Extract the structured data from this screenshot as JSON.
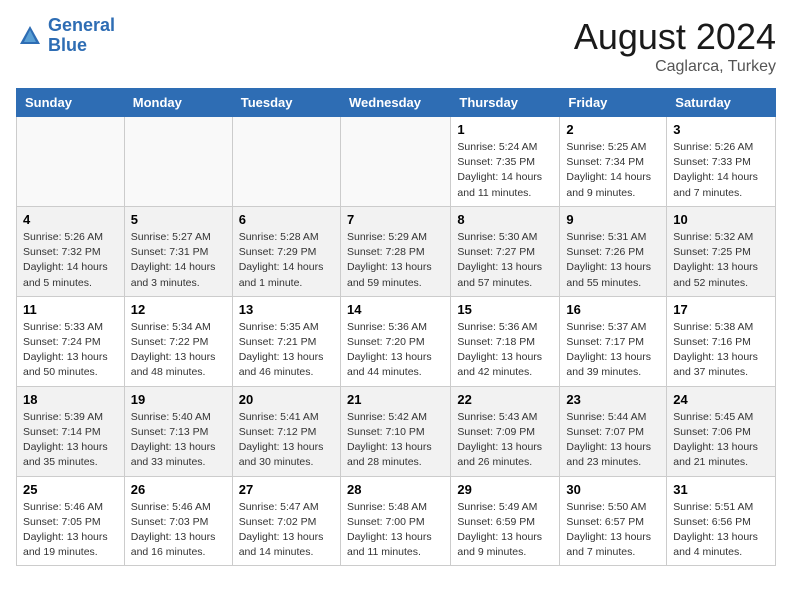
{
  "header": {
    "logo_line1": "General",
    "logo_line2": "Blue",
    "month": "August 2024",
    "location": "Caglarca, Turkey"
  },
  "weekdays": [
    "Sunday",
    "Monday",
    "Tuesday",
    "Wednesday",
    "Thursday",
    "Friday",
    "Saturday"
  ],
  "weeks": [
    [
      {
        "day": "",
        "info": ""
      },
      {
        "day": "",
        "info": ""
      },
      {
        "day": "",
        "info": ""
      },
      {
        "day": "",
        "info": ""
      },
      {
        "day": "1",
        "info": "Sunrise: 5:24 AM\nSunset: 7:35 PM\nDaylight: 14 hours\nand 11 minutes."
      },
      {
        "day": "2",
        "info": "Sunrise: 5:25 AM\nSunset: 7:34 PM\nDaylight: 14 hours\nand 9 minutes."
      },
      {
        "day": "3",
        "info": "Sunrise: 5:26 AM\nSunset: 7:33 PM\nDaylight: 14 hours\nand 7 minutes."
      }
    ],
    [
      {
        "day": "4",
        "info": "Sunrise: 5:26 AM\nSunset: 7:32 PM\nDaylight: 14 hours\nand 5 minutes."
      },
      {
        "day": "5",
        "info": "Sunrise: 5:27 AM\nSunset: 7:31 PM\nDaylight: 14 hours\nand 3 minutes."
      },
      {
        "day": "6",
        "info": "Sunrise: 5:28 AM\nSunset: 7:29 PM\nDaylight: 14 hours\nand 1 minute."
      },
      {
        "day": "7",
        "info": "Sunrise: 5:29 AM\nSunset: 7:28 PM\nDaylight: 13 hours\nand 59 minutes."
      },
      {
        "day": "8",
        "info": "Sunrise: 5:30 AM\nSunset: 7:27 PM\nDaylight: 13 hours\nand 57 minutes."
      },
      {
        "day": "9",
        "info": "Sunrise: 5:31 AM\nSunset: 7:26 PM\nDaylight: 13 hours\nand 55 minutes."
      },
      {
        "day": "10",
        "info": "Sunrise: 5:32 AM\nSunset: 7:25 PM\nDaylight: 13 hours\nand 52 minutes."
      }
    ],
    [
      {
        "day": "11",
        "info": "Sunrise: 5:33 AM\nSunset: 7:24 PM\nDaylight: 13 hours\nand 50 minutes."
      },
      {
        "day": "12",
        "info": "Sunrise: 5:34 AM\nSunset: 7:22 PM\nDaylight: 13 hours\nand 48 minutes."
      },
      {
        "day": "13",
        "info": "Sunrise: 5:35 AM\nSunset: 7:21 PM\nDaylight: 13 hours\nand 46 minutes."
      },
      {
        "day": "14",
        "info": "Sunrise: 5:36 AM\nSunset: 7:20 PM\nDaylight: 13 hours\nand 44 minutes."
      },
      {
        "day": "15",
        "info": "Sunrise: 5:36 AM\nSunset: 7:18 PM\nDaylight: 13 hours\nand 42 minutes."
      },
      {
        "day": "16",
        "info": "Sunrise: 5:37 AM\nSunset: 7:17 PM\nDaylight: 13 hours\nand 39 minutes."
      },
      {
        "day": "17",
        "info": "Sunrise: 5:38 AM\nSunset: 7:16 PM\nDaylight: 13 hours\nand 37 minutes."
      }
    ],
    [
      {
        "day": "18",
        "info": "Sunrise: 5:39 AM\nSunset: 7:14 PM\nDaylight: 13 hours\nand 35 minutes."
      },
      {
        "day": "19",
        "info": "Sunrise: 5:40 AM\nSunset: 7:13 PM\nDaylight: 13 hours\nand 33 minutes."
      },
      {
        "day": "20",
        "info": "Sunrise: 5:41 AM\nSunset: 7:12 PM\nDaylight: 13 hours\nand 30 minutes."
      },
      {
        "day": "21",
        "info": "Sunrise: 5:42 AM\nSunset: 7:10 PM\nDaylight: 13 hours\nand 28 minutes."
      },
      {
        "day": "22",
        "info": "Sunrise: 5:43 AM\nSunset: 7:09 PM\nDaylight: 13 hours\nand 26 minutes."
      },
      {
        "day": "23",
        "info": "Sunrise: 5:44 AM\nSunset: 7:07 PM\nDaylight: 13 hours\nand 23 minutes."
      },
      {
        "day": "24",
        "info": "Sunrise: 5:45 AM\nSunset: 7:06 PM\nDaylight: 13 hours\nand 21 minutes."
      }
    ],
    [
      {
        "day": "25",
        "info": "Sunrise: 5:46 AM\nSunset: 7:05 PM\nDaylight: 13 hours\nand 19 minutes."
      },
      {
        "day": "26",
        "info": "Sunrise: 5:46 AM\nSunset: 7:03 PM\nDaylight: 13 hours\nand 16 minutes."
      },
      {
        "day": "27",
        "info": "Sunrise: 5:47 AM\nSunset: 7:02 PM\nDaylight: 13 hours\nand 14 minutes."
      },
      {
        "day": "28",
        "info": "Sunrise: 5:48 AM\nSunset: 7:00 PM\nDaylight: 13 hours\nand 11 minutes."
      },
      {
        "day": "29",
        "info": "Sunrise: 5:49 AM\nSunset: 6:59 PM\nDaylight: 13 hours\nand 9 minutes."
      },
      {
        "day": "30",
        "info": "Sunrise: 5:50 AM\nSunset: 6:57 PM\nDaylight: 13 hours\nand 7 minutes."
      },
      {
        "day": "31",
        "info": "Sunrise: 5:51 AM\nSunset: 6:56 PM\nDaylight: 13 hours\nand 4 minutes."
      }
    ]
  ]
}
